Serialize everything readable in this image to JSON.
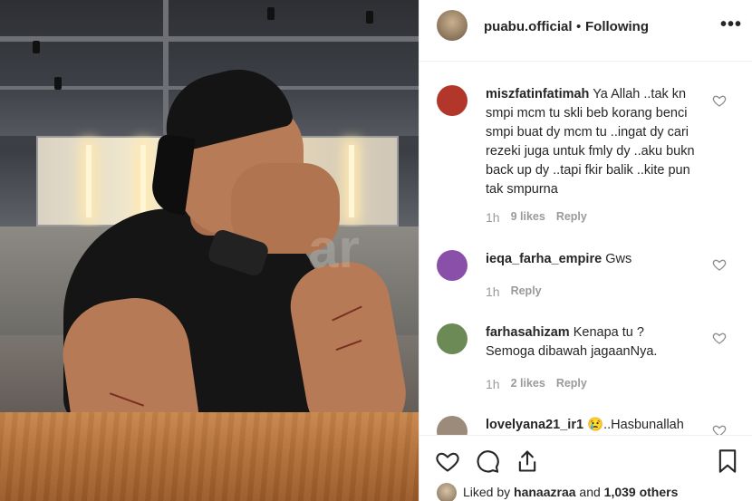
{
  "post": {
    "username": "puabu.official",
    "separator": "•",
    "follow_status": "Following",
    "more_icon": "more-horizontal-icon",
    "watermark": "ar"
  },
  "comments": [
    {
      "username": "miszfatinfatimah",
      "text": "Ya Allah ..tak kn smpi mcm tu skli beb korang benci smpi buat dy mcm tu ..ingat dy cari rezeki juga untuk fmly dy ..aku bukn back up dy ..tapi fkir balik ..kite pun tak smpurna",
      "time": "1h",
      "likes": "9 likes",
      "reply": "Reply",
      "avatar_color": "#b3362b"
    },
    {
      "username": "ieqa_farha_empire",
      "text": "Gws",
      "time": "1h",
      "likes": "",
      "reply": "Reply",
      "avatar_color": "#8a4fa8"
    },
    {
      "username": "farhasahizam",
      "text": "Kenapa tu ? Semoga dibawah jagaanNya.",
      "time": "1h",
      "likes": "2 likes",
      "reply": "Reply",
      "avatar_color": "#6b8a55"
    },
    {
      "username": "lovelyana21_ir1",
      "text": "😢..Hasbunallah",
      "time": "",
      "likes": "",
      "reply": "",
      "avatar_color": "#9c8a7a"
    }
  ],
  "actions": {
    "like_icon": "heart-icon",
    "comment_icon": "comment-icon",
    "share_icon": "share-icon",
    "save_icon": "bookmark-icon"
  },
  "likes_summary": {
    "prefix": "Liked by",
    "user": "hanaazraa",
    "middle": "and",
    "count": "1,039 others"
  }
}
